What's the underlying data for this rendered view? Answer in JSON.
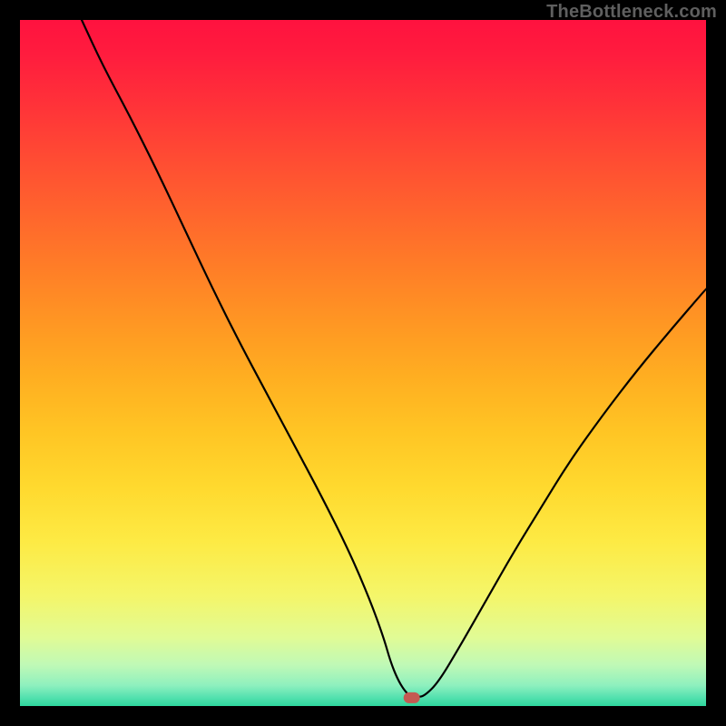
{
  "attribution": "TheBottleneck.com",
  "chart_data": {
    "type": "line",
    "title": "",
    "xlabel": "",
    "ylabel": "",
    "xlim": [
      0,
      100
    ],
    "ylim": [
      0,
      100
    ],
    "grid": false,
    "annotations": [
      {
        "kind": "marker",
        "shape": "pill",
        "color": "#c45a52",
        "x": 57.1,
        "y": 1.2
      }
    ],
    "series": [
      {
        "name": "bottleneck-curve",
        "color": "#000000",
        "x": [
          9.0,
          12.0,
          16.0,
          20.0,
          24.0,
          28.0,
          32.0,
          36.0,
          40.0,
          44.0,
          48.0,
          51.0,
          53.0,
          54.0,
          55.0,
          56.0,
          57.0,
          58.0,
          59.0,
          61.0,
          64.0,
          68.0,
          72.0,
          76.0,
          80.0,
          85.0,
          90.0,
          95.0,
          100.0
        ],
        "values": [
          100.0,
          93.5,
          86.0,
          78.0,
          69.5,
          61.0,
          53.0,
          45.5,
          38.0,
          30.5,
          22.5,
          15.5,
          10.0,
          6.5,
          4.0,
          2.3,
          1.3,
          1.3,
          1.5,
          3.5,
          8.5,
          15.5,
          22.5,
          29.0,
          35.5,
          42.5,
          49.0,
          55.0,
          60.8
        ]
      }
    ],
    "background_gradient": {
      "direction": "vertical",
      "stops": [
        {
          "offset": 0.0,
          "color": "#ff123f"
        },
        {
          "offset": 0.05,
          "color": "#ff1c3e"
        },
        {
          "offset": 0.12,
          "color": "#ff3139"
        },
        {
          "offset": 0.2,
          "color": "#ff4b33"
        },
        {
          "offset": 0.28,
          "color": "#ff642d"
        },
        {
          "offset": 0.36,
          "color": "#ff7d27"
        },
        {
          "offset": 0.44,
          "color": "#ff9623"
        },
        {
          "offset": 0.52,
          "color": "#ffae21"
        },
        {
          "offset": 0.6,
          "color": "#ffc524"
        },
        {
          "offset": 0.68,
          "color": "#ffd92e"
        },
        {
          "offset": 0.76,
          "color": "#fdea44"
        },
        {
          "offset": 0.84,
          "color": "#f4f66a"
        },
        {
          "offset": 0.9,
          "color": "#e1fb95"
        },
        {
          "offset": 0.94,
          "color": "#c0f9b6"
        },
        {
          "offset": 0.97,
          "color": "#8ef0be"
        },
        {
          "offset": 0.985,
          "color": "#5ce3b2"
        },
        {
          "offset": 1.0,
          "color": "#2ed69d"
        }
      ]
    }
  }
}
